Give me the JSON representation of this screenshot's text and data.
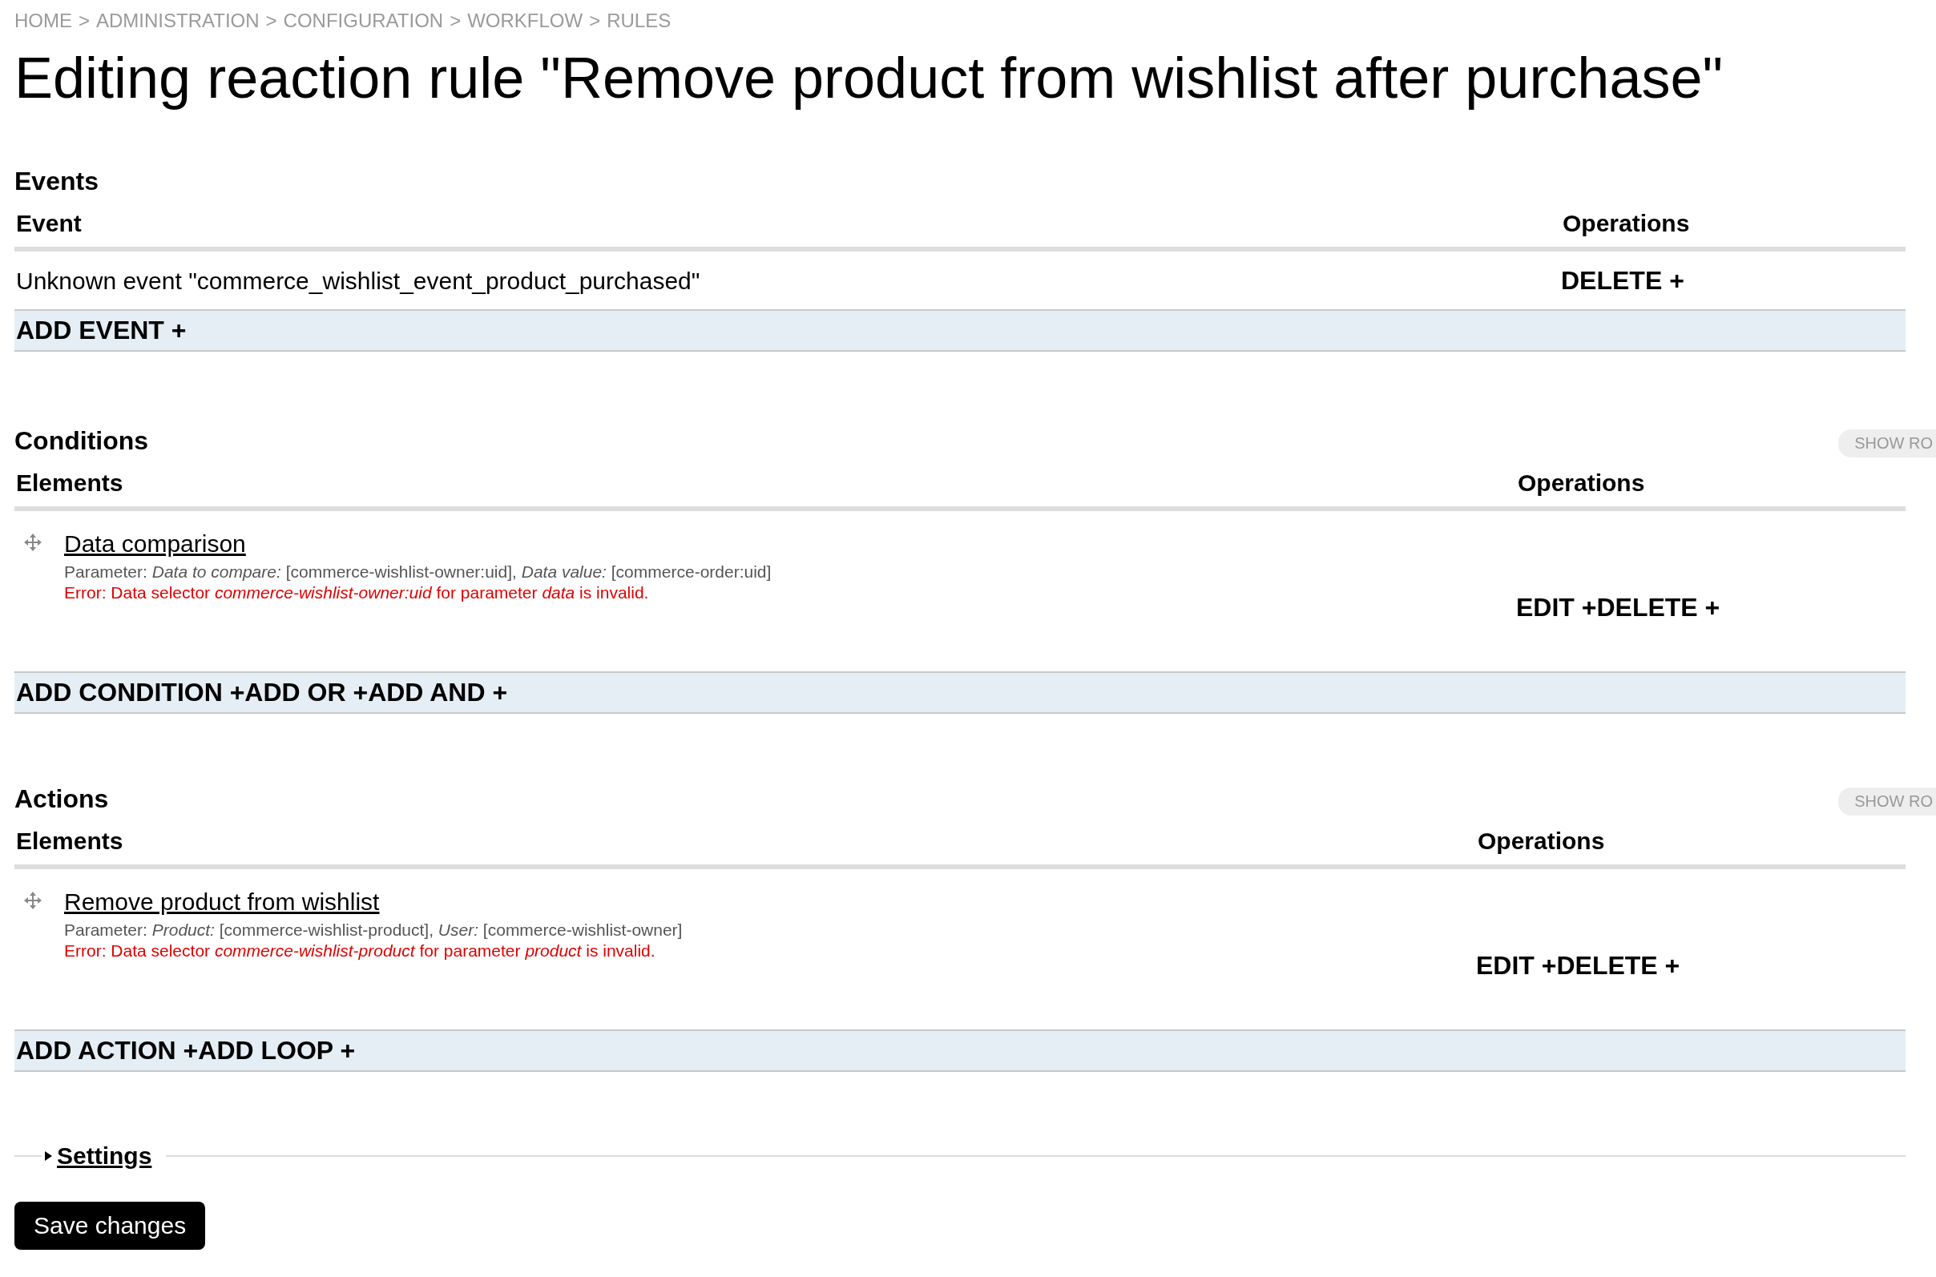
{
  "breadcrumb": [
    "HOME",
    "ADMINISTRATION",
    "CONFIGURATION",
    "WORKFLOW",
    "RULES"
  ],
  "breadcrumb_separator": ">",
  "title": "Editing reaction rule \"Remove product from wishlist after purchase\"",
  "sections": [
    {
      "kind": "events",
      "heading": "Events",
      "columns": [
        "Event",
        "Operations"
      ],
      "rows": [
        {
          "label": "Unknown event \"commerce_wishlist_event_product_purchased\"",
          "operations": [
            "DELETE +"
          ]
        }
      ],
      "add_links": [
        "ADD EVENT +"
      ]
    },
    {
      "kind": "elements",
      "heading": "Conditions",
      "show_rows": "SHOW RO",
      "columns": [
        "Elements",
        "Operations"
      ],
      "rows": [
        {
          "label": "Data comparison",
          "parameter": "Parameter: *Data to compare:* [commerce-wishlist-owner:uid], *Data value:* [commerce-order:uid]",
          "error": "Error: Data selector *commerce-wishlist-owner:uid* for parameter *data* is invalid.",
          "operations": [
            "EDIT +",
            "DELETE +"
          ]
        }
      ],
      "add_links": [
        "ADD CONDITION +",
        "ADD OR +",
        "ADD AND +"
      ]
    },
    {
      "kind": "elements",
      "heading": "Actions",
      "show_rows": "SHOW RO",
      "columns": [
        "Elements",
        "Operations"
      ],
      "rows": [
        {
          "label": "Remove product from wishlist",
          "parameter": "Parameter: *Product:* [commerce-wishlist-product], *User:* [commerce-wishlist-owner]",
          "error": "Error: Data selector *commerce-wishlist-product* for parameter *product* is invalid.",
          "operations": [
            "EDIT +",
            "DELETE +"
          ]
        }
      ],
      "add_links": [
        "ADD ACTION +",
        "ADD LOOP +"
      ]
    }
  ],
  "settings": {
    "label": "Settings",
    "expanded": false
  },
  "save_button": "Save changes"
}
